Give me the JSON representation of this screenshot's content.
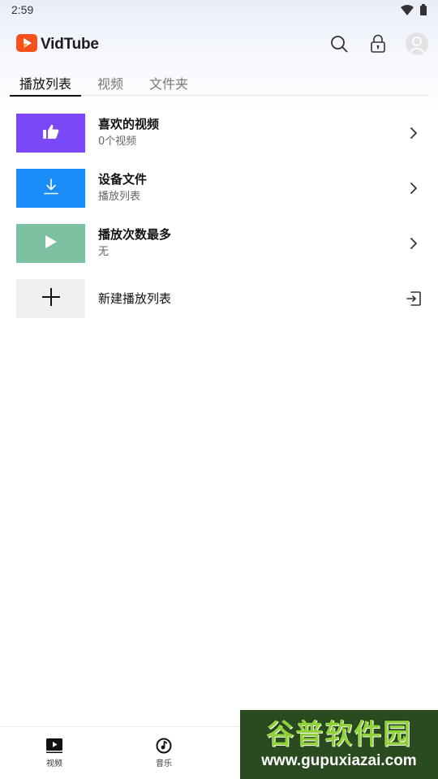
{
  "status_bar": {
    "time": "2:59"
  },
  "app": {
    "name": "VidTube"
  },
  "header": {
    "icons": [
      "search-icon",
      "lock-icon",
      "avatar-icon"
    ]
  },
  "tabs": [
    {
      "label": "播放列表",
      "active": true
    },
    {
      "label": "视频",
      "active": false
    },
    {
      "label": "文件夹",
      "active": false
    }
  ],
  "playlists": [
    {
      "title": "喜欢的视频",
      "subtitle": "0个视频",
      "icon": "thumbs-up-icon",
      "color": "#7a48f6"
    },
    {
      "title": "设备文件",
      "subtitle": "播放列表",
      "icon": "download-icon",
      "color": "#1b8cf8"
    },
    {
      "title": "播放次数最多",
      "subtitle": "无",
      "icon": "play-icon",
      "color": "#7cc2a2"
    }
  ],
  "new_playlist": {
    "label": "新建播放列表",
    "icon": "plus-icon",
    "color": "#f0f0f0"
  },
  "bottom_nav": [
    {
      "label": "视频",
      "icon": "video-icon"
    },
    {
      "label": "音乐",
      "icon": "music-icon"
    }
  ],
  "watermark": {
    "text_cn": "谷普软件园",
    "url": "www.gupuxiazai.com"
  },
  "colors": {
    "accent": "#111111",
    "logo": "#f4511e"
  }
}
